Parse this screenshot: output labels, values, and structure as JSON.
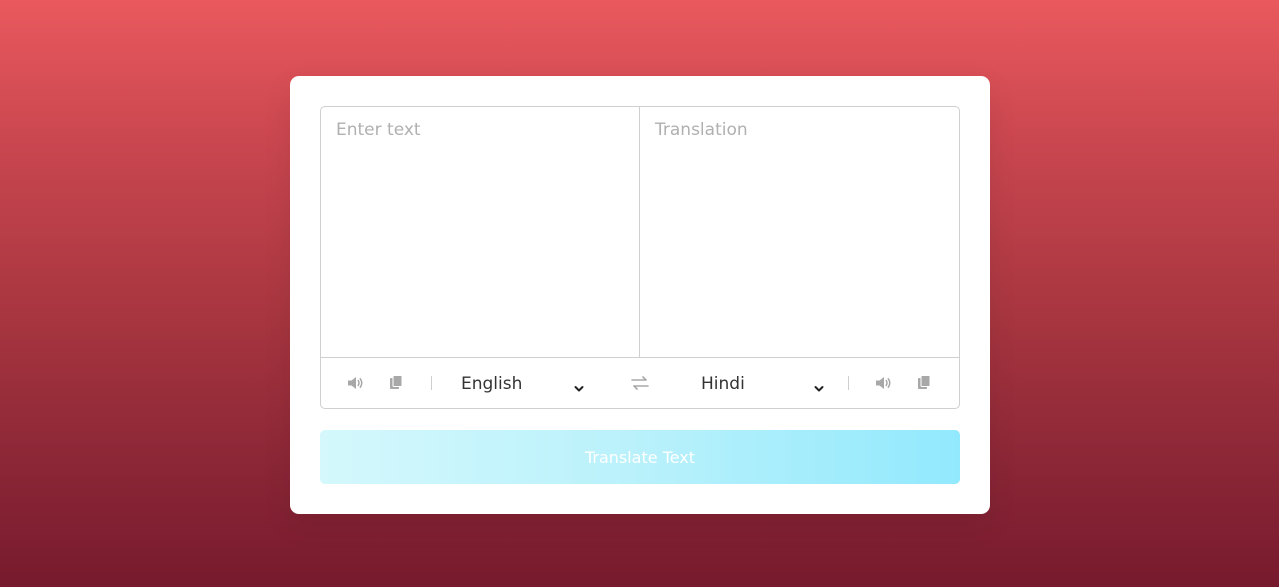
{
  "source": {
    "placeholder": "Enter text",
    "value": "",
    "language": "English"
  },
  "target": {
    "placeholder": "Translation",
    "value": "",
    "language": "Hindi"
  },
  "button": {
    "label": "Translate Text"
  },
  "colors": {
    "background_top": "#e9595d",
    "background_bottom": "#771a2d",
    "button_start": "#d4f8fc",
    "button_end": "#92e9fd",
    "icon": "#a8a8a8"
  },
  "icons": {
    "speaker": "volume-icon",
    "copy": "copy-icon",
    "swap": "exchange-icon",
    "dropdown": "chevron-down-icon"
  }
}
